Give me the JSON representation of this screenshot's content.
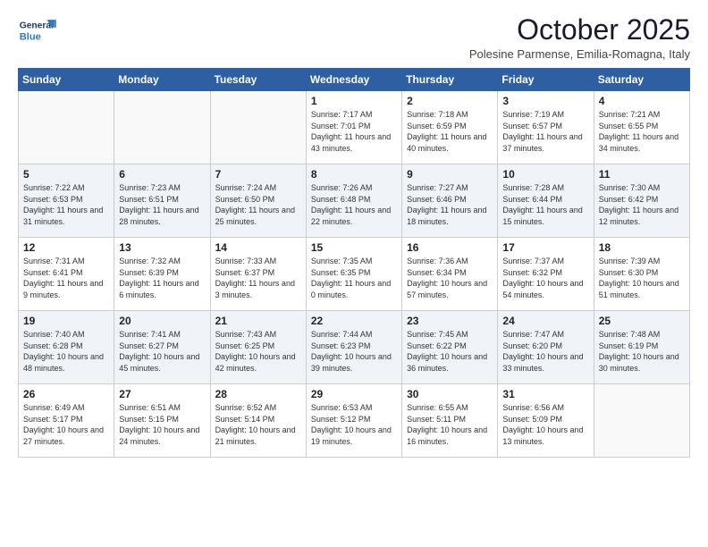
{
  "logo": {
    "line1": "General",
    "line2": "Blue"
  },
  "title": "October 2025",
  "location": "Polesine Parmense, Emilia-Romagna, Italy",
  "days_of_week": [
    "Sunday",
    "Monday",
    "Tuesday",
    "Wednesday",
    "Thursday",
    "Friday",
    "Saturday"
  ],
  "weeks": [
    [
      {
        "day": "",
        "info": ""
      },
      {
        "day": "",
        "info": ""
      },
      {
        "day": "",
        "info": ""
      },
      {
        "day": "1",
        "info": "Sunrise: 7:17 AM\nSunset: 7:01 PM\nDaylight: 11 hours and 43 minutes."
      },
      {
        "day": "2",
        "info": "Sunrise: 7:18 AM\nSunset: 6:59 PM\nDaylight: 11 hours and 40 minutes."
      },
      {
        "day": "3",
        "info": "Sunrise: 7:19 AM\nSunset: 6:57 PM\nDaylight: 11 hours and 37 minutes."
      },
      {
        "day": "4",
        "info": "Sunrise: 7:21 AM\nSunset: 6:55 PM\nDaylight: 11 hours and 34 minutes."
      }
    ],
    [
      {
        "day": "5",
        "info": "Sunrise: 7:22 AM\nSunset: 6:53 PM\nDaylight: 11 hours and 31 minutes."
      },
      {
        "day": "6",
        "info": "Sunrise: 7:23 AM\nSunset: 6:51 PM\nDaylight: 11 hours and 28 minutes."
      },
      {
        "day": "7",
        "info": "Sunrise: 7:24 AM\nSunset: 6:50 PM\nDaylight: 11 hours and 25 minutes."
      },
      {
        "day": "8",
        "info": "Sunrise: 7:26 AM\nSunset: 6:48 PM\nDaylight: 11 hours and 22 minutes."
      },
      {
        "day": "9",
        "info": "Sunrise: 7:27 AM\nSunset: 6:46 PM\nDaylight: 11 hours and 18 minutes."
      },
      {
        "day": "10",
        "info": "Sunrise: 7:28 AM\nSunset: 6:44 PM\nDaylight: 11 hours and 15 minutes."
      },
      {
        "day": "11",
        "info": "Sunrise: 7:30 AM\nSunset: 6:42 PM\nDaylight: 11 hours and 12 minutes."
      }
    ],
    [
      {
        "day": "12",
        "info": "Sunrise: 7:31 AM\nSunset: 6:41 PM\nDaylight: 11 hours and 9 minutes."
      },
      {
        "day": "13",
        "info": "Sunrise: 7:32 AM\nSunset: 6:39 PM\nDaylight: 11 hours and 6 minutes."
      },
      {
        "day": "14",
        "info": "Sunrise: 7:33 AM\nSunset: 6:37 PM\nDaylight: 11 hours and 3 minutes."
      },
      {
        "day": "15",
        "info": "Sunrise: 7:35 AM\nSunset: 6:35 PM\nDaylight: 11 hours and 0 minutes."
      },
      {
        "day": "16",
        "info": "Sunrise: 7:36 AM\nSunset: 6:34 PM\nDaylight: 10 hours and 57 minutes."
      },
      {
        "day": "17",
        "info": "Sunrise: 7:37 AM\nSunset: 6:32 PM\nDaylight: 10 hours and 54 minutes."
      },
      {
        "day": "18",
        "info": "Sunrise: 7:39 AM\nSunset: 6:30 PM\nDaylight: 10 hours and 51 minutes."
      }
    ],
    [
      {
        "day": "19",
        "info": "Sunrise: 7:40 AM\nSunset: 6:28 PM\nDaylight: 10 hours and 48 minutes."
      },
      {
        "day": "20",
        "info": "Sunrise: 7:41 AM\nSunset: 6:27 PM\nDaylight: 10 hours and 45 minutes."
      },
      {
        "day": "21",
        "info": "Sunrise: 7:43 AM\nSunset: 6:25 PM\nDaylight: 10 hours and 42 minutes."
      },
      {
        "day": "22",
        "info": "Sunrise: 7:44 AM\nSunset: 6:23 PM\nDaylight: 10 hours and 39 minutes."
      },
      {
        "day": "23",
        "info": "Sunrise: 7:45 AM\nSunset: 6:22 PM\nDaylight: 10 hours and 36 minutes."
      },
      {
        "day": "24",
        "info": "Sunrise: 7:47 AM\nSunset: 6:20 PM\nDaylight: 10 hours and 33 minutes."
      },
      {
        "day": "25",
        "info": "Sunrise: 7:48 AM\nSunset: 6:19 PM\nDaylight: 10 hours and 30 minutes."
      }
    ],
    [
      {
        "day": "26",
        "info": "Sunrise: 6:49 AM\nSunset: 5:17 PM\nDaylight: 10 hours and 27 minutes."
      },
      {
        "day": "27",
        "info": "Sunrise: 6:51 AM\nSunset: 5:15 PM\nDaylight: 10 hours and 24 minutes."
      },
      {
        "day": "28",
        "info": "Sunrise: 6:52 AM\nSunset: 5:14 PM\nDaylight: 10 hours and 21 minutes."
      },
      {
        "day": "29",
        "info": "Sunrise: 6:53 AM\nSunset: 5:12 PM\nDaylight: 10 hours and 19 minutes."
      },
      {
        "day": "30",
        "info": "Sunrise: 6:55 AM\nSunset: 5:11 PM\nDaylight: 10 hours and 16 minutes."
      },
      {
        "day": "31",
        "info": "Sunrise: 6:56 AM\nSunset: 5:09 PM\nDaylight: 10 hours and 13 minutes."
      },
      {
        "day": "",
        "info": ""
      }
    ]
  ]
}
